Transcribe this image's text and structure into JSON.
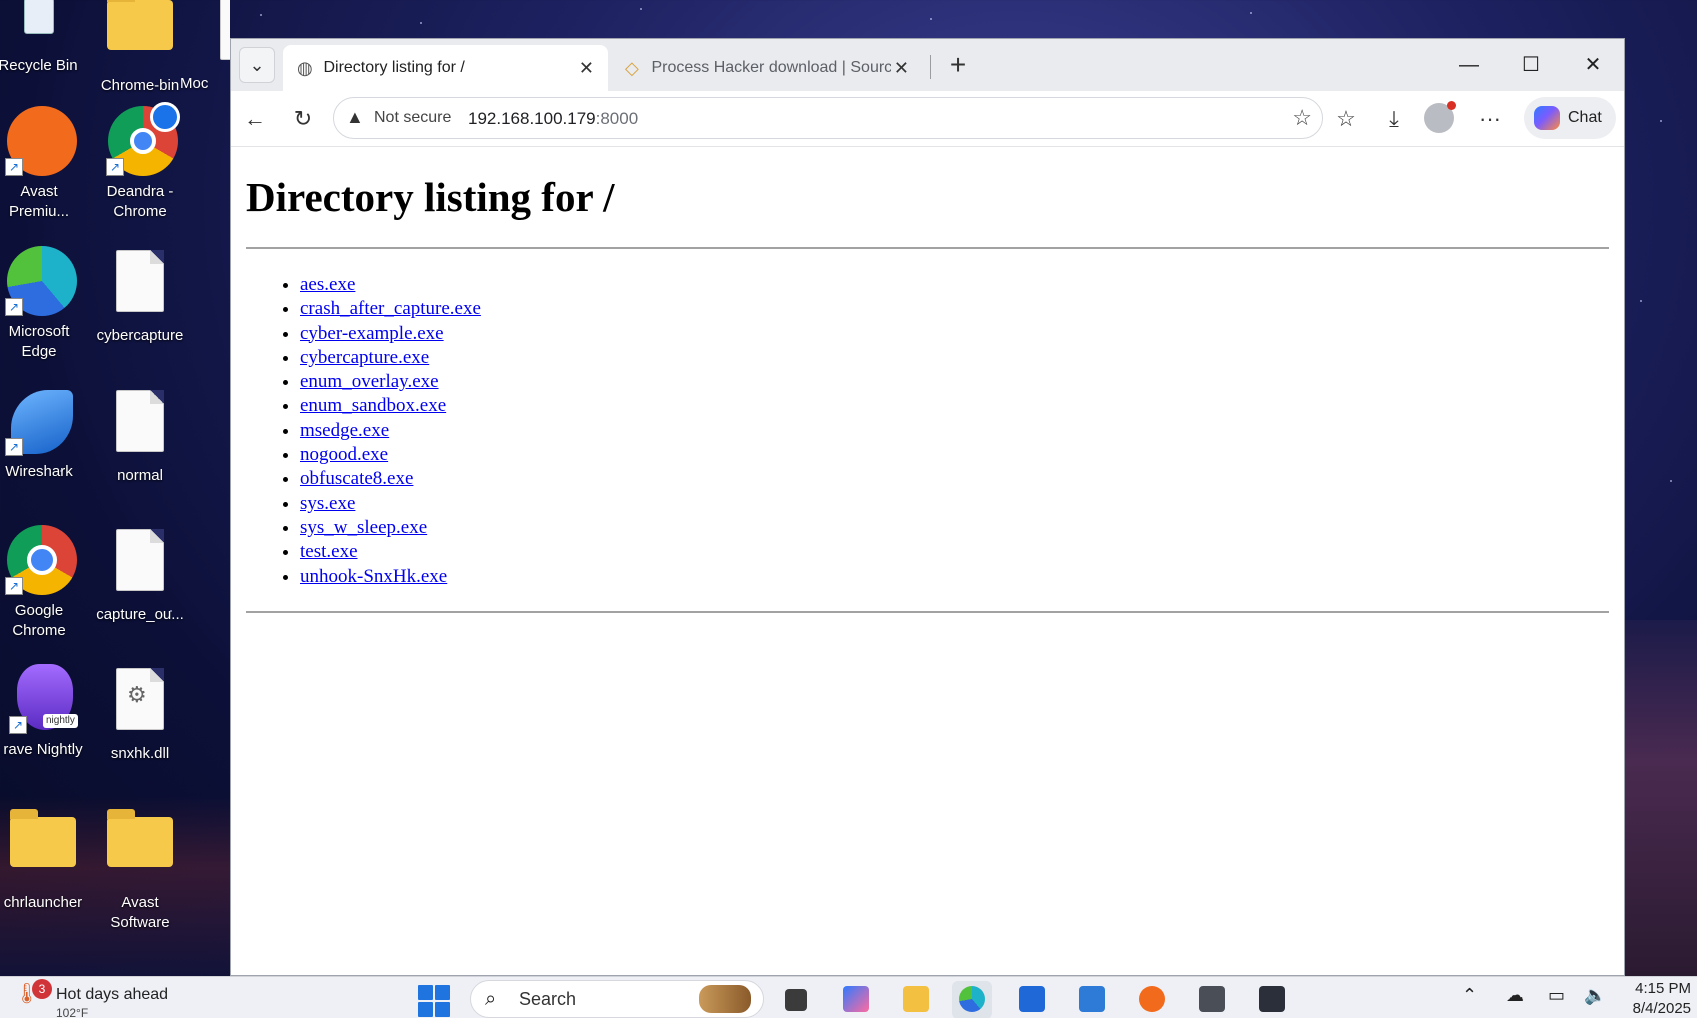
{
  "desktop": {
    "icons": [
      {
        "label": "Recycle Bin"
      },
      {
        "label": "Chrome-bin"
      },
      {
        "label": "Moc"
      },
      {
        "label": "Avast Premiu..."
      },
      {
        "label": "Deandra - Chrome"
      },
      {
        "label": "Microsoft Edge"
      },
      {
        "label": "cybercapture"
      },
      {
        "label": "Wireshark"
      },
      {
        "label": "normal"
      },
      {
        "label": "Google Chrome"
      },
      {
        "label": "capture_ou..."
      },
      {
        "label": "rave Nightly"
      },
      {
        "label": "snxhk.dll"
      },
      {
        "label": "chrlauncher"
      },
      {
        "label": "Avast Software"
      }
    ],
    "nightly_badge": "nightly"
  },
  "browser": {
    "tabs": [
      {
        "title": "Directory listing for /",
        "icon": "globe-icon",
        "active": true
      },
      {
        "title": "Process Hacker download | Source",
        "icon": "process-hacker-icon",
        "active": false
      }
    ],
    "address": {
      "security_label": "Not secure",
      "host": "192.168.100.179",
      "port": ":8000"
    },
    "chat_label": "Chat"
  },
  "page": {
    "heading": "Directory listing for /",
    "files": [
      "aes.exe",
      "crash_after_capture.exe",
      "cyber-example.exe",
      "cybercapture.exe",
      "enum_overlay.exe",
      "enum_sandbox.exe",
      "msedge.exe",
      "nogood.exe",
      "obfuscate8.exe",
      "sys.exe",
      "sys_w_sleep.exe",
      "test.exe",
      "unhook-SnxHk.exe"
    ]
  },
  "taskbar": {
    "weather": {
      "badge": "3",
      "title": "Hot days ahead",
      "temp": "102°F"
    },
    "search_placeholder": "Search",
    "clock": {
      "time": "4:15 PM",
      "date": "8/4/2025"
    }
  },
  "colors": {
    "link": "#0000ee",
    "accent": "#1f74e0"
  }
}
